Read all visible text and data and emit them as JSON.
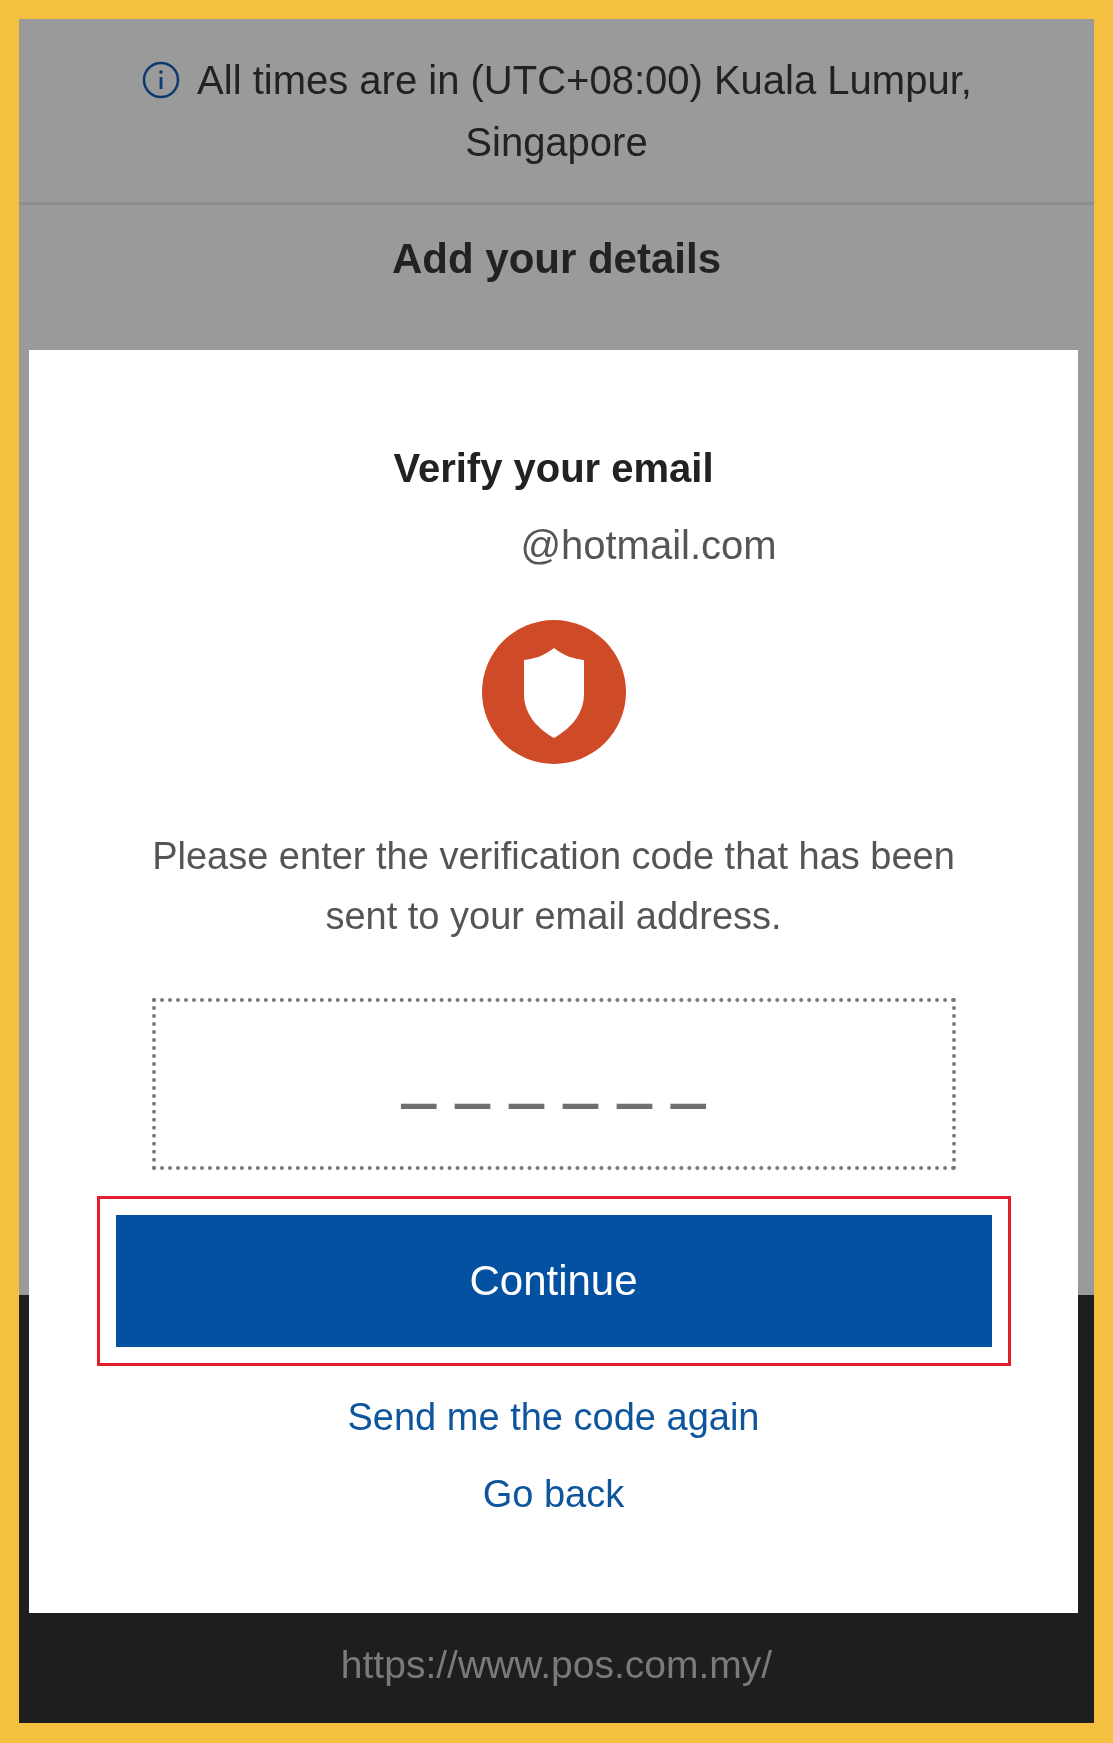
{
  "timezone_notice": "All times are in (UTC+08:00) Kuala Lumpur, Singapore",
  "section_title": "Add your details",
  "footer": {
    "url": "https://www.pos.com.my/"
  },
  "dialog": {
    "title": "Verify your email",
    "email": "@hotmail.com",
    "instructions": "Please enter the verification code that has been sent to your email address.",
    "code_field": {
      "placeholder": "— — — — — —"
    },
    "continue_button": {
      "label": "Continue",
      "highlighted": true
    },
    "links": [
      "Send me the code again",
      "Go back"
    ]
  }
}
